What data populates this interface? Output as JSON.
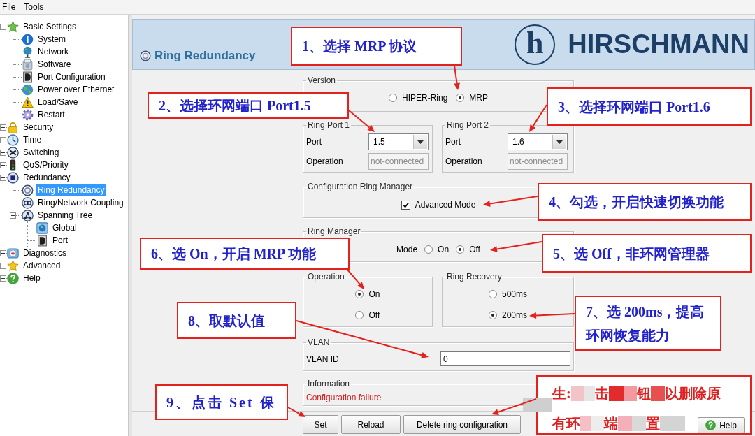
{
  "menu": [
    {
      "label": "File"
    },
    {
      "label": "Tools"
    }
  ],
  "tree": [
    {
      "label": "Basic Settings",
      "kind": "folder",
      "expanded": true,
      "selected": false,
      "children": [
        {
          "label": "System",
          "kind": "page",
          "selected": false
        },
        {
          "label": "Network",
          "kind": "page",
          "selected": false
        },
        {
          "label": "Software",
          "kind": "page",
          "selected": false
        },
        {
          "label": "Port Configuration",
          "kind": "page",
          "selected": false
        },
        {
          "label": "Power over Ethernet",
          "kind": "page",
          "selected": false
        },
        {
          "label": "Load/Save",
          "kind": "page",
          "selected": false
        },
        {
          "label": "Restart",
          "kind": "page",
          "selected": false
        }
      ]
    },
    {
      "label": "Security",
      "kind": "folder",
      "expanded": false,
      "selected": false
    },
    {
      "label": "Time",
      "kind": "folder",
      "expanded": false,
      "selected": false
    },
    {
      "label": "Switching",
      "kind": "folder",
      "expanded": false,
      "selected": false
    },
    {
      "label": "QoS/Priority",
      "kind": "folder",
      "expanded": false,
      "selected": false
    },
    {
      "label": "Redundancy",
      "kind": "folder",
      "expanded": true,
      "selected": false,
      "children": [
        {
          "label": "Ring Redundancy",
          "kind": "page",
          "selected": true
        },
        {
          "label": "Ring/Network Coupling",
          "kind": "page",
          "selected": false
        },
        {
          "label": "Spanning Tree",
          "kind": "folder",
          "expanded": true,
          "selected": false,
          "children": [
            {
              "label": "Global",
              "kind": "page",
              "selected": false
            },
            {
              "label": "Port",
              "kind": "page",
              "selected": false
            }
          ]
        }
      ]
    },
    {
      "label": "Diagnostics",
      "kind": "folder",
      "expanded": false,
      "selected": false
    },
    {
      "label": "Advanced",
      "kind": "folder",
      "expanded": false,
      "selected": false
    },
    {
      "label": "Help",
      "kind": "folder",
      "expanded": false,
      "selected": false
    }
  ],
  "page": {
    "title": "Ring Redundancy",
    "logo": {
      "mark": "h",
      "name": "HIRSCHMANN"
    }
  },
  "form": {
    "version": {
      "title": "Version",
      "options": [
        {
          "label": "HIPER-Ring",
          "selected": false
        },
        {
          "label": "MRP",
          "selected": true
        }
      ]
    },
    "ring_ports": [
      {
        "title": "Ring Port 1",
        "port": {
          "label": "Port",
          "value": "1.5"
        },
        "operation": {
          "label": "Operation",
          "value": "not-connected",
          "disabled": true
        }
      },
      {
        "title": "Ring Port 2",
        "port": {
          "label": "Port",
          "value": "1.6"
        },
        "operation": {
          "label": "Operation",
          "value": "not-connected",
          "disabled": true
        }
      }
    ],
    "configuration_ring_manager": {
      "title": "Configuration Ring Manager",
      "advanced_mode": {
        "label": "Advanced Mode",
        "checked": true
      }
    },
    "ring_manager": {
      "title": "Ring Manager",
      "mode_label": "Mode",
      "options": [
        {
          "label": "On",
          "selected": false
        },
        {
          "label": "Off",
          "selected": true
        }
      ]
    },
    "operation": {
      "title": "Operation",
      "options": [
        {
          "label": "On",
          "selected": true
        },
        {
          "label": "Off",
          "selected": false
        }
      ]
    },
    "ring_recovery": {
      "title": "Ring Recovery",
      "options": [
        {
          "label": "500ms",
          "selected": false
        },
        {
          "label": "200ms",
          "selected": true
        }
      ]
    },
    "vlan": {
      "title": "VLAN",
      "label": "VLAN ID",
      "value": "0"
    },
    "information": {
      "title": "Information",
      "message": "Configuration failure"
    }
  },
  "buttons": [
    {
      "label": "Set",
      "kind": "action"
    },
    {
      "label": "Reload",
      "kind": "action"
    },
    {
      "label": "Delete ring configuration",
      "kind": "action"
    },
    {
      "label": "Help",
      "kind": "help"
    }
  ],
  "callouts": [
    {
      "text": "1、选择 MRP 协议"
    },
    {
      "text": "2、选择环网端口 Port1.5"
    },
    {
      "text": "3、选择环网端口 Port1.6"
    },
    {
      "text": "4、勾选，开启快速切换功能"
    },
    {
      "text": "6、选 On，开启 MRP 功能"
    },
    {
      "text": "5、选 Off，非环网管理器"
    },
    {
      "text": "8、取默认值"
    },
    {
      "text": "7、选 200ms，提高环网恢复能力"
    },
    {
      "text": "9、点击 Set 保"
    }
  ],
  "note": {
    "lines": [
      [
        "生:",
        "击",
        "钮",
        "以删除原"
      ],
      [
        "有环",
        "端",
        "置"
      ]
    ]
  }
}
